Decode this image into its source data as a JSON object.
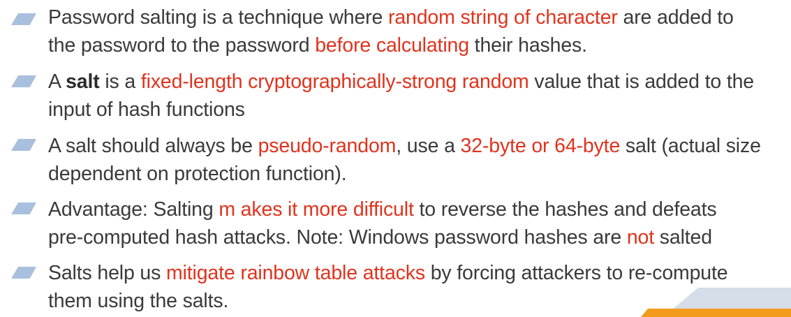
{
  "bullets": [
    {
      "line1": [
        {
          "t": "Password salting is a technique where "
        },
        {
          "t": "random string of character",
          "s": "red"
        },
        {
          "t": " are added to"
        }
      ],
      "line2": [
        {
          "t": "the password to the password "
        },
        {
          "t": "before calculating",
          "s": "red"
        },
        {
          "t": " their hashes."
        }
      ]
    },
    {
      "line1": [
        {
          "t": "A "
        },
        {
          "t": "salt",
          "s": "bold"
        },
        {
          "t": " is a "
        },
        {
          "t": "fixed-length cryptographically-strong random",
          "s": "red"
        },
        {
          "t": " value that is added to the"
        }
      ],
      "line2": [
        {
          "t": "input of hash functions"
        }
      ]
    },
    {
      "line1": [
        {
          "t": "A salt should always be "
        },
        {
          "t": "pseudo-random",
          "s": "red"
        },
        {
          "t": ", use a "
        },
        {
          "t": "32-byte or 64-byte",
          "s": "red"
        },
        {
          "t": " salt (actual size"
        }
      ],
      "line2": [
        {
          "t": "dependent on protection function)."
        }
      ]
    },
    {
      "line1": [
        {
          "t": "Advantage: Salting "
        },
        {
          "t": "m  akes it more difficult",
          "s": "red"
        },
        {
          "t": " to reverse the hashes and defeats"
        }
      ],
      "line2": [
        {
          "t": "pre-computed hash attacks. Note: Windows password hashes are "
        },
        {
          "t": "not",
          "s": "red"
        },
        {
          "t": " salted"
        }
      ]
    },
    {
      "line1": [
        {
          "t": "Salts help us "
        },
        {
          "t": "mitigate rainbow table attacks",
          "s": "red"
        },
        {
          "t": " by forcing attackers to re-compute"
        }
      ],
      "line2": [
        {
          "t": "them using the salts."
        }
      ]
    }
  ],
  "colors": {
    "text": "#3a3a3a",
    "highlight": "#e0331d",
    "bullet": "#a9bfde",
    "corner_accent": "#f29b1d",
    "corner_light": "#d4dde8"
  }
}
